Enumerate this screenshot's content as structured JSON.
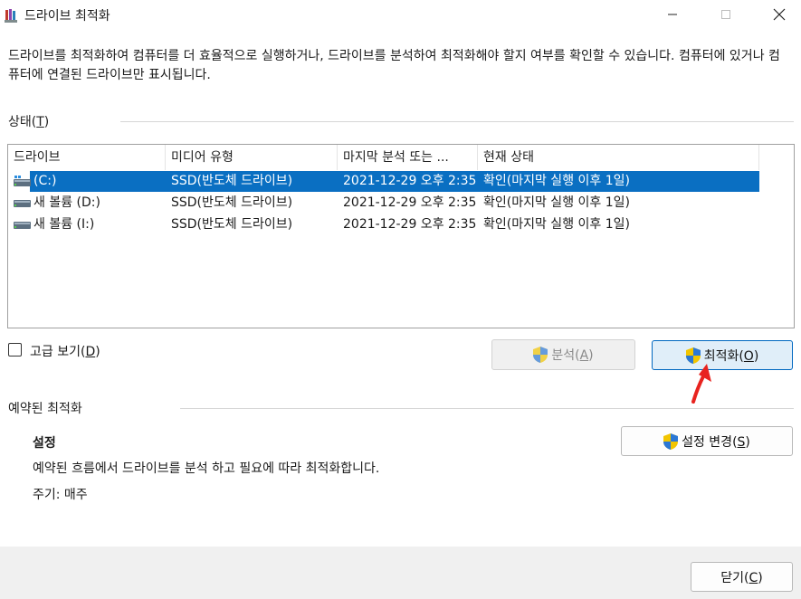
{
  "window": {
    "title": "드라이브 최적화"
  },
  "description": "드라이브를 최적화하여 컴퓨터를 더 효율적으로 실행하거나, 드라이브를 분석하여 최적화해야 할지 여부를 확인할 수 있습니다. 컴퓨터에 있거나 컴퓨터에 연결된 드라이브만 표시됩니다.",
  "status": {
    "label": "상태(T)",
    "label_text": "상태(",
    "label_key": "T",
    "label_end": ")",
    "columns": [
      "드라이브",
      "미디어 유형",
      "마지막 분석 또는 ...",
      "현재 상태"
    ],
    "rows": [
      {
        "drive": "(C:)",
        "media": "SSD(반도체 드라이브)",
        "last": "2021-12-29 오후 2:35",
        "state": "확인(마지막 실행 이후 1일)",
        "selected": true,
        "icon": "system-drive-icon"
      },
      {
        "drive": "새 볼륨 (D:)",
        "media": "SSD(반도체 드라이브)",
        "last": "2021-12-29 오후 2:35",
        "state": "확인(마지막 실행 이후 1일)",
        "selected": false,
        "icon": "drive-icon"
      },
      {
        "drive": "새 볼륨 (I:)",
        "media": "SSD(반도체 드라이브)",
        "last": "2021-12-29 오후 2:35",
        "state": "확인(마지막 실행 이후 1일)",
        "selected": false,
        "icon": "drive-icon"
      }
    ]
  },
  "advanced_view": {
    "text": "고급 보기(",
    "key": "D",
    "end": ")",
    "checked": false
  },
  "buttons": {
    "analyze": {
      "text": "분석(",
      "key": "A",
      "end": ")",
      "enabled": false
    },
    "optimize": {
      "text": "최적화(",
      "key": "O",
      "end": ")",
      "enabled": true
    },
    "settings": {
      "text": "설정 변경(",
      "key": "S",
      "end": ")"
    },
    "close": {
      "text": "닫기(",
      "key": "C",
      "end": ")"
    }
  },
  "scheduled": {
    "section_label": "예약된 최적화",
    "settings_title": "설정",
    "settings_desc": "예약된 흐름에서 드라이브를 분석 하고 필요에 따라 최적화합니다.",
    "frequency": "주기: 매주"
  },
  "colors": {
    "selection": "#0a6fc2",
    "accent": "#0067c0",
    "annotation_arrow": "#e8231f"
  }
}
